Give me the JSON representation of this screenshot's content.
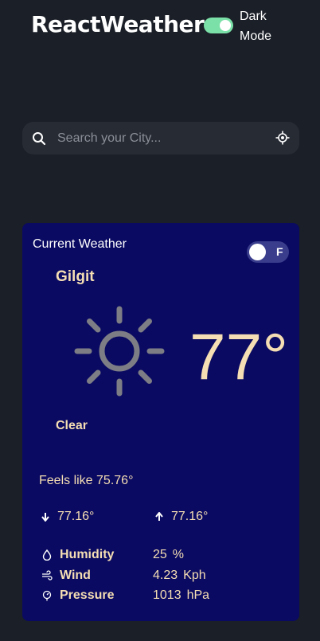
{
  "header": {
    "brand": "ReactWeather",
    "mode_label": "Dark Mode",
    "dark_mode_on": true
  },
  "search": {
    "placeholder": "Search your City...",
    "icon": "search-icon",
    "locate_icon": "crosshair-icon"
  },
  "current": {
    "title": "Current Weather",
    "unit_letter": "F",
    "city": "Gilgit",
    "icon": "sun-icon",
    "temperature": "77°",
    "condition": "Clear",
    "feels_like": "Feels like 75.76°",
    "min_temp": "77.16°",
    "max_temp": "77.16°"
  },
  "stats": [
    {
      "icon": "droplet-icon",
      "label": "Humidity",
      "value": "25",
      "unit": "%"
    },
    {
      "icon": "wind-icon",
      "label": "Wind",
      "value": "4.23",
      "unit": "Kph"
    },
    {
      "icon": "gauge-icon",
      "label": "Pressure",
      "value": "1013",
      "unit": "hPa"
    }
  ],
  "colors": {
    "background": "#1b1f27",
    "card": "#0a0a62",
    "accent_text": "#f5deb3",
    "toggle_on": "#7be0a8"
  }
}
